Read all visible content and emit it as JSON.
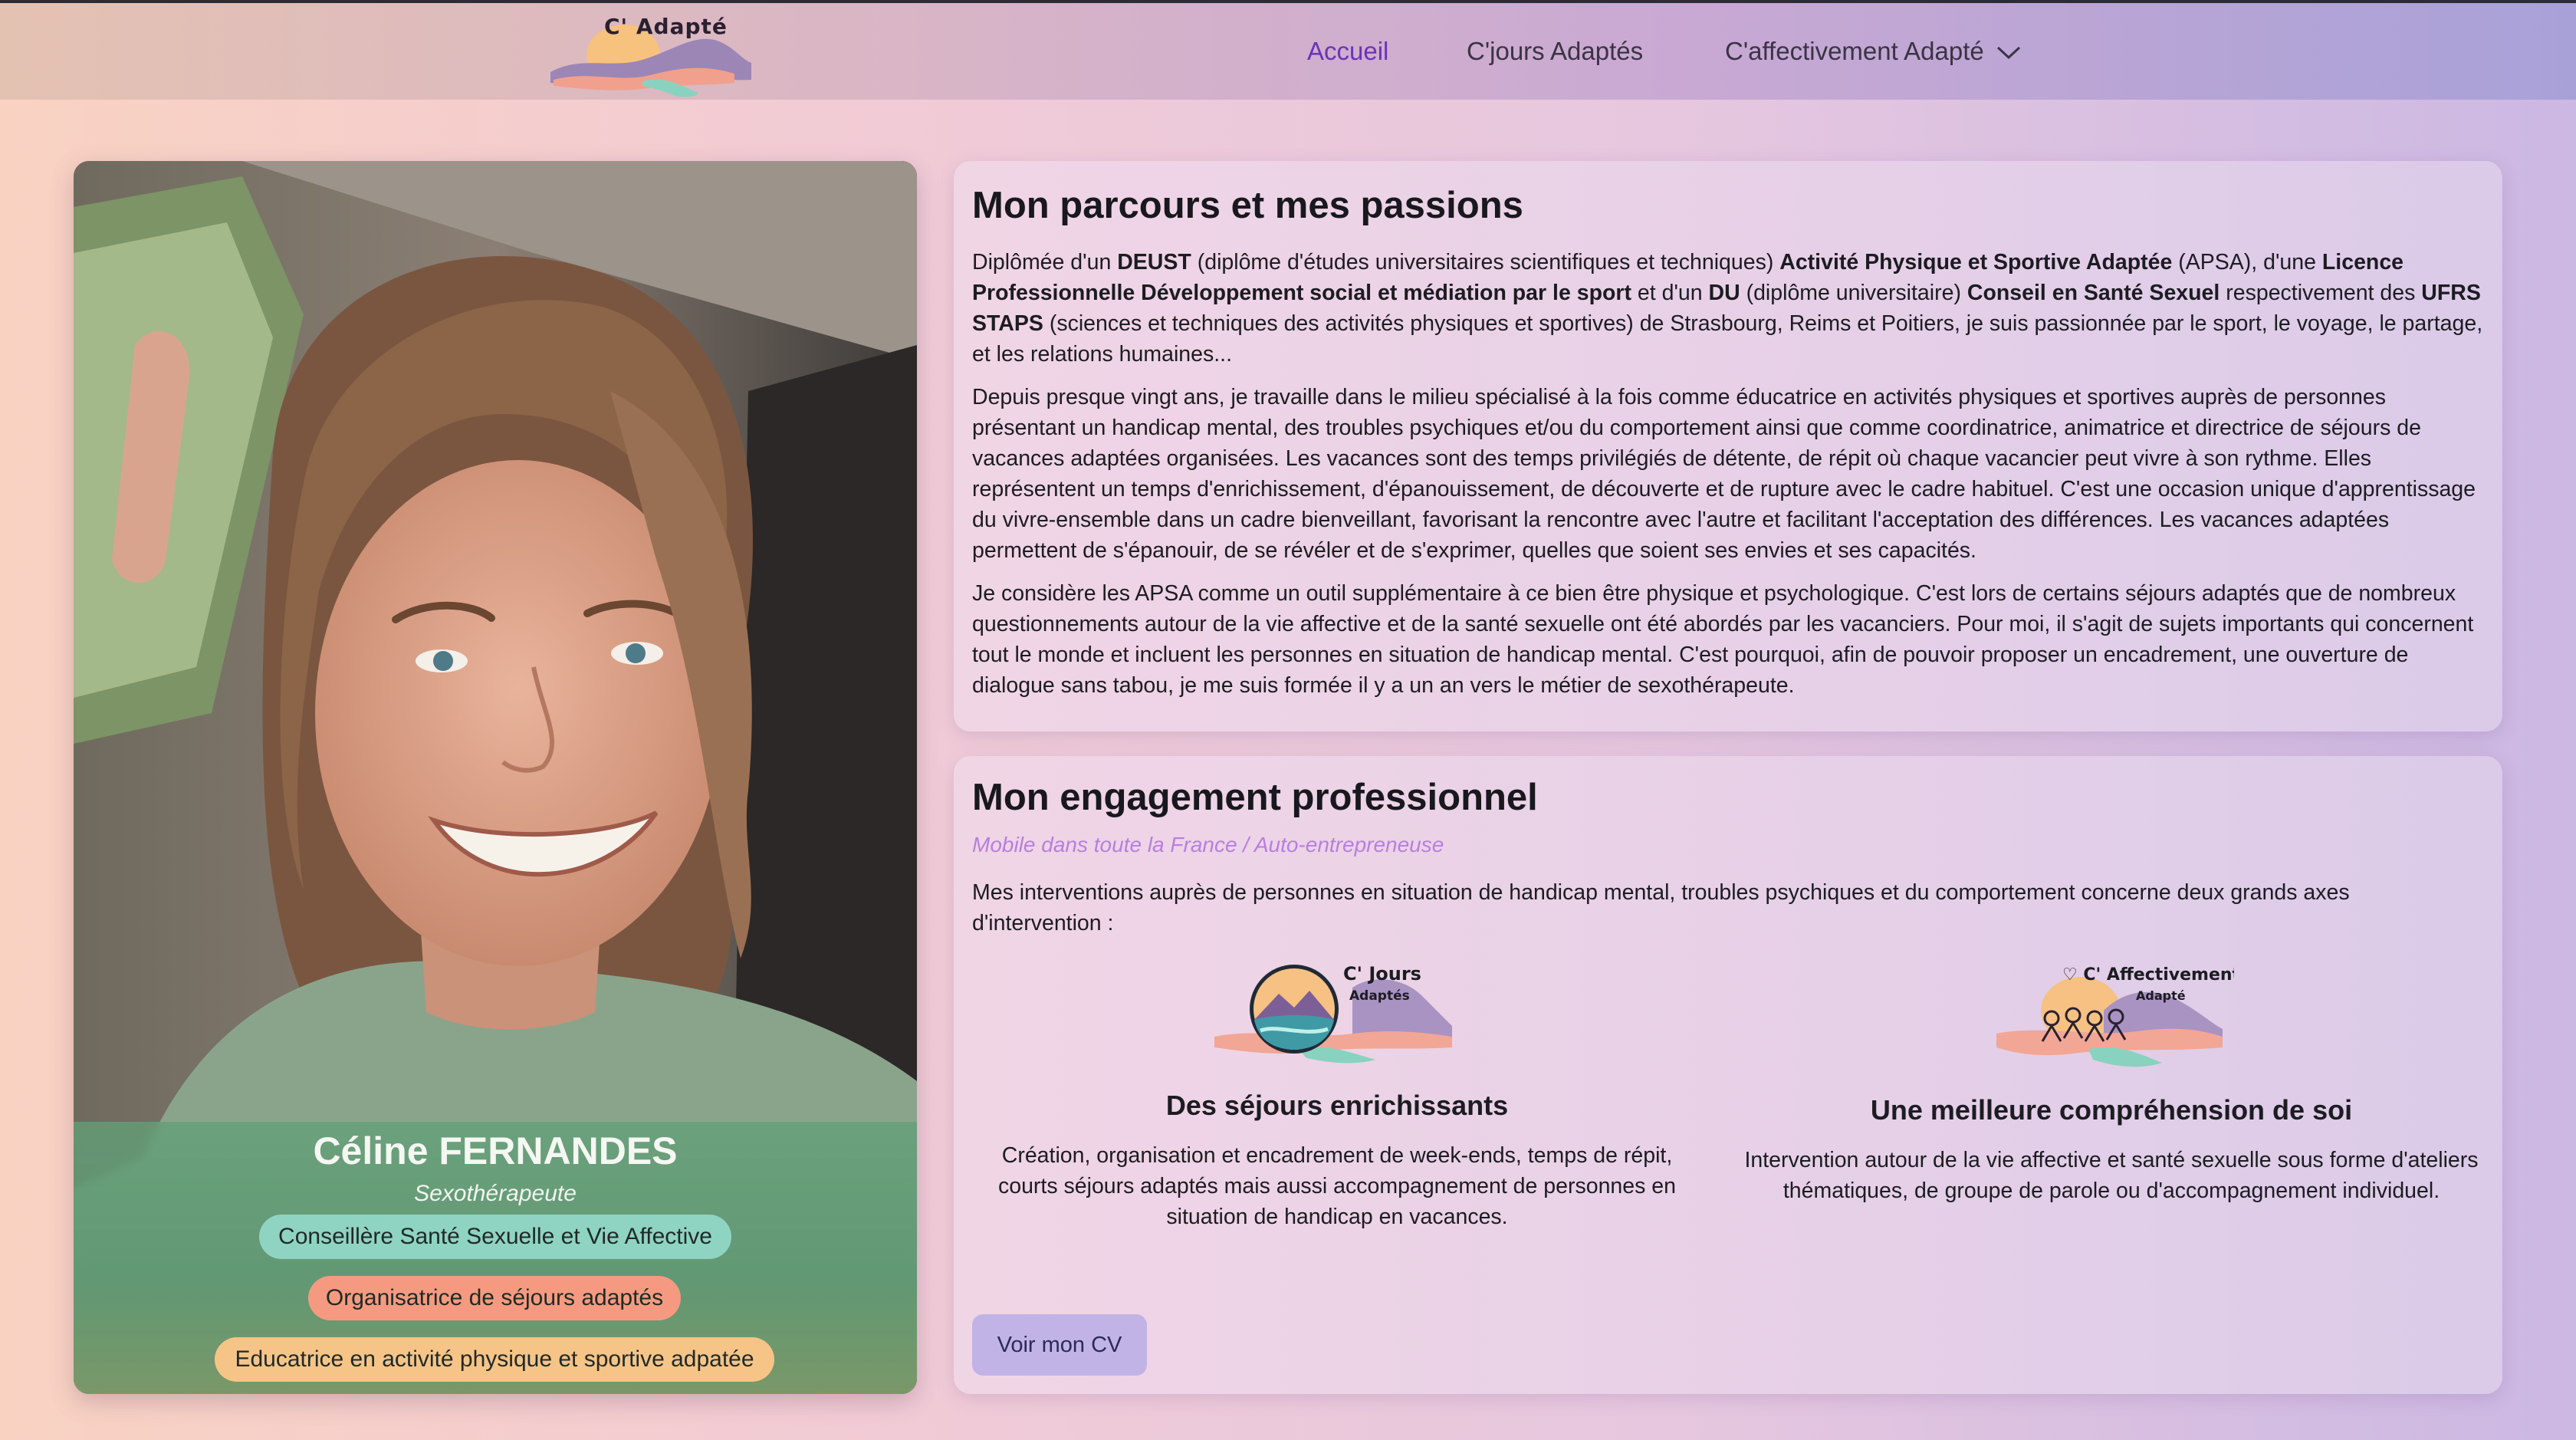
{
  "brand": {
    "logo_text": "C' Adapté",
    "colors": {
      "accent": "#6b33b8",
      "tag_green": "#8fd3c3",
      "tag_salmon": "#f59a80",
      "tag_orange": "#f7c487",
      "button": "#c2b3e6"
    }
  },
  "nav": {
    "items": [
      {
        "label": "Accueil",
        "active": true
      },
      {
        "label": "C'jours Adaptés",
        "active": false
      },
      {
        "label": "C'affectivement Adapté",
        "active": false,
        "icon": "chevron-down-icon"
      }
    ]
  },
  "profile": {
    "name": "Céline FERNANDES",
    "role": "Sexothérapeute",
    "tags": [
      "Conseillère Santé Sexuelle et Vie Affective",
      "Organisatrice de séjours adaptés",
      "Educatrice en activité physique et sportive adpatée"
    ]
  },
  "parcours": {
    "title": "Mon parcours et mes passions",
    "p1": {
      "t1": "Diplômée d'un ",
      "b1": "DEUST",
      "t2": " (diplôme d'études universitaires scientifiques et techniques) ",
      "b2": "Activité Physique et Sportive Adaptée",
      "t3": " (APSA), d'une ",
      "b3": "Licence Professionnelle Développement social et médiation par le sport",
      "t4": " et d'un ",
      "b4": "DU",
      "t5": " (diplôme universitaire) ",
      "b5": "Conseil en Santé Sexuel",
      "t6": " respectivement des ",
      "b6": "UFRS STAPS",
      "t7": " (sciences et techniques des activités physiques et sportives) de Strasbourg, Reims et Poitiers, je suis passionnée par le sport, le voyage, le partage, et les relations humaines..."
    },
    "p2": "Depuis presque vingt ans, je travaille dans le milieu spécialisé à la fois comme éducatrice en activités physiques et sportives auprès de personnes présentant un handicap mental, des troubles psychiques et/ou du comportement ainsi que comme coordinatrice, animatrice et directrice de séjours de vacances adaptées organisées. Les vacances sont des temps privilégiés de détente, de répit où chaque vacancier peut vivre à son rythme. Elles représentent un temps d'enrichissement, d'épanouissement, de découverte et de rupture avec le cadre habituel. C'est une occasion unique d'apprentissage du vivre-ensemble dans un cadre bienveillant, favorisant la rencontre avec l'autre et facilitant l'acceptation des différences. Les vacances adaptées permettent de s'épanouir, de se révéler et de s'exprimer, quelles que soient ses envies et ses capacités.",
    "p3": "Je considère les APSA comme un outil supplémentaire à ce bien être physique et psychologique. C'est lors de certains séjours adaptés que de nombreux questionnements autour de la vie affective et de la santé sexuelle ont été abordés par les vacanciers. Pour moi, il s'agit de sujets importants qui concernent tout le monde et incluent les personnes en situation de handicap mental. C'est pourquoi, afin de pouvoir proposer un encadrement, une ouverture de dialogue sans tabou, je me suis formée il y a un an vers le métier de sexothérapeute."
  },
  "engagement": {
    "title": "Mon engagement professionnel",
    "subtitle": "Mobile dans toute la France / Auto-entrepreneuse",
    "intro": "Mes interventions auprès de personnes en situation de handicap mental, troubles psychiques et du comportement concerne deux grands axes d'intervention :",
    "axes": [
      {
        "logo_line1": "C' Jours",
        "logo_line2": "Adaptés",
        "title": "Des séjours enrichissants",
        "text": "Création, organisation et encadrement de week-ends, temps de répit, courts séjours adaptés mais aussi accompagnement de personnes en situation de handicap en vacances."
      },
      {
        "logo_line1": "♡ C' Affectivement",
        "logo_line2": "Adapté",
        "title": "Une meilleure compréhension de soi",
        "text": "Intervention autour de la vie affective et santé sexuelle sous forme d'ateliers thématiques, de groupe de parole ou d'accompagnement individuel."
      }
    ],
    "cv_button": "Voir mon CV"
  }
}
